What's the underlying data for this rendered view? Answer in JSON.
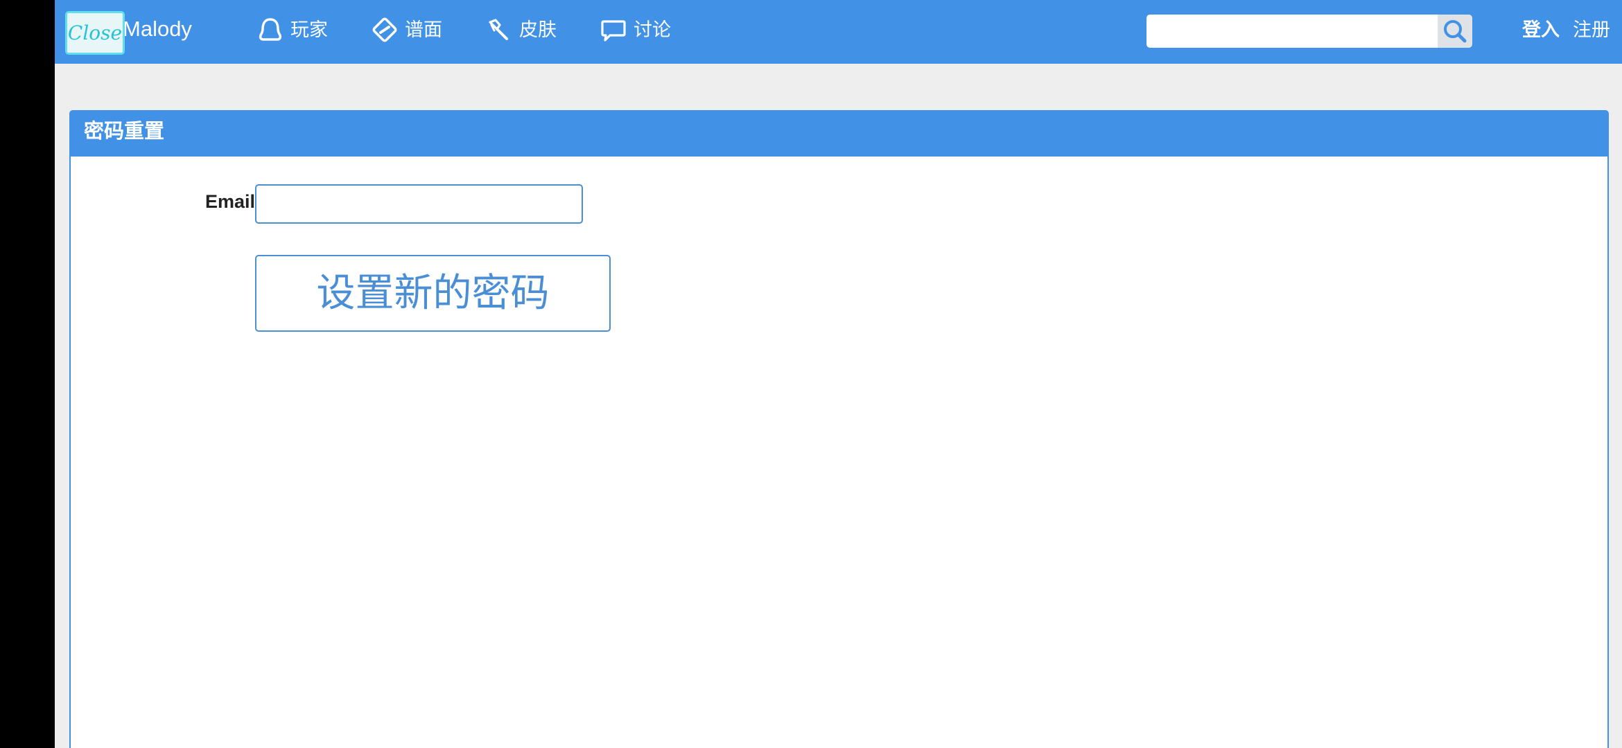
{
  "header": {
    "close_label": "Close",
    "brand": "Malody",
    "nav": [
      {
        "label": "玩家",
        "icon": "user-icon"
      },
      {
        "label": "谱面",
        "icon": "chart-icon"
      },
      {
        "label": "皮肤",
        "icon": "skin-icon"
      },
      {
        "label": "讨论",
        "icon": "chat-icon"
      }
    ],
    "search": {
      "value": "",
      "placeholder": "",
      "icon": "search-icon"
    },
    "login_label": "登入",
    "register_label": "注册"
  },
  "panel": {
    "title": "密码重置",
    "email_label": "Email",
    "email_value": "",
    "submit_label": "设置新的密码"
  },
  "colors": {
    "primary": "#4191e6",
    "page_bg": "#eeeeee",
    "close_accent": "#25c3d6",
    "button_text": "#4a8fd6"
  }
}
